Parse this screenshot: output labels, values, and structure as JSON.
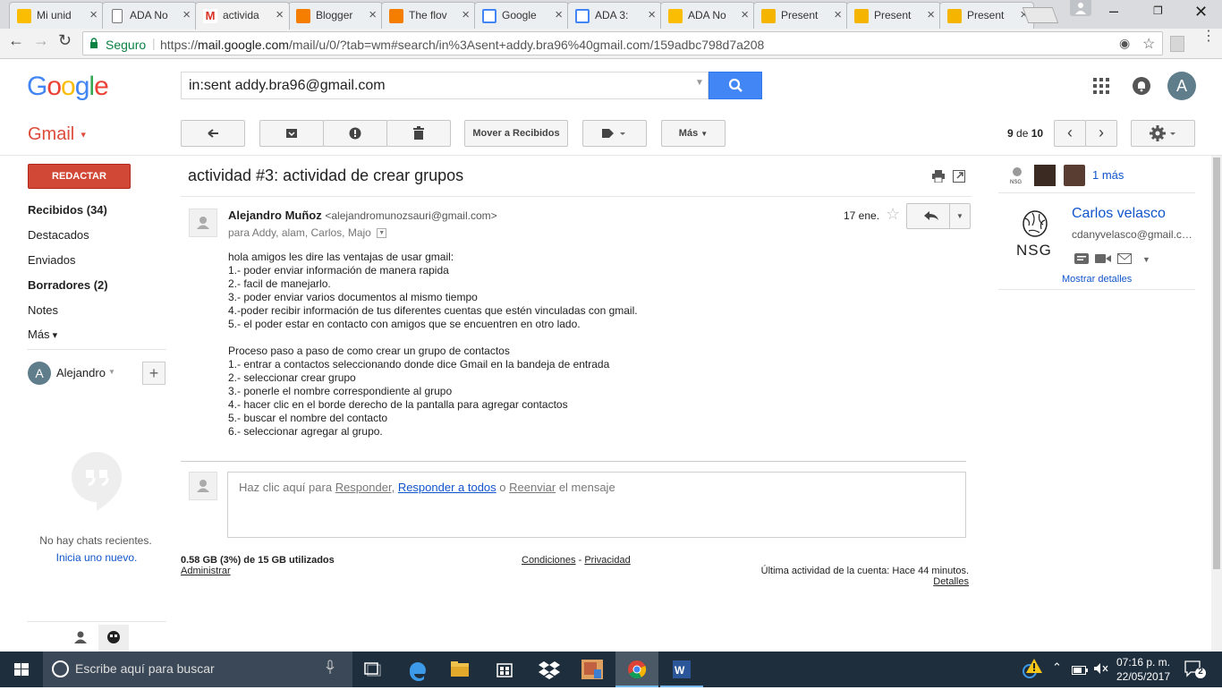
{
  "browser": {
    "tabs": [
      {
        "label": "Mi unid",
        "icon": "google-drive-icon"
      },
      {
        "label": "ADA No",
        "icon": "document-icon"
      },
      {
        "label": "activida",
        "icon": "gmail-icon"
      },
      {
        "label": "Blogger",
        "icon": "blogger-icon"
      },
      {
        "label": "The flov",
        "icon": "blogger-icon"
      },
      {
        "label": "Google",
        "icon": "google-forms-icon"
      },
      {
        "label": "ADA 3:",
        "icon": "google-forms-icon"
      },
      {
        "label": "ADA No",
        "icon": "google-drive-icon"
      },
      {
        "label": "Present",
        "icon": "slides-icon"
      },
      {
        "label": "Present",
        "icon": "slides-icon"
      },
      {
        "label": "Present",
        "icon": "slides-icon"
      }
    ],
    "secure_label": "Seguro",
    "url_scheme": "https://",
    "url_host": "mail.google.com",
    "url_path": "/mail/u/0/?tab=wm#search/in%3Asent+addy.bra96%40gmail.com/159adbc798d7a208",
    "colors": {
      "secure": "#0b8043",
      "tabbar": "#dadbde"
    }
  },
  "header": {
    "logo": "Google",
    "search_value": "in:sent addy.bra96@gmail.com",
    "avatar_letter": "A"
  },
  "toolbar": {
    "app_name": "Gmail",
    "move_to_inbox": "Mover a Recibidos",
    "more": "Más",
    "page_current": "9",
    "page_of": "de",
    "page_total": "10"
  },
  "sidebar": {
    "compose": "REDACTAR",
    "items": [
      {
        "label": "Recibidos (34)",
        "bold": true
      },
      {
        "label": "Destacados",
        "bold": false
      },
      {
        "label": "Enviados",
        "bold": false
      },
      {
        "label": "Borradores (2)",
        "bold": true
      },
      {
        "label": "Notes",
        "bold": false
      },
      {
        "label": "Más",
        "bold": false
      }
    ],
    "hangouts_user": "Alejandro",
    "hangouts_avatar": "A",
    "no_chats": "No hay chats recientes.",
    "start_new": "Inicia uno nuevo."
  },
  "thread": {
    "subject": "actividad #3: actividad de crear grupos",
    "sender_name": "Alejandro Muñoz",
    "sender_email": "<alejandromunozsauri@gmail.com>",
    "recipients": "para Addy, alam, Carlos, Majo",
    "date": "17 ene.",
    "body": [
      "hola amigos les dire las ventajas de usar gmail:",
      "1.- poder enviar información de manera rapida",
      "2.- facil de manejarlo.",
      "3.- poder enviar varios documentos al mismo tiempo",
      "4.-poder recibir información de tus diferentes cuentas que estén vinculadas con gmail.",
      "5.- el poder estar en contacto con amigos que se encuentren en otro lado.",
      "",
      "Proceso paso a paso de como crear un grupo de contactos",
      "1.- entrar a contactos seleccionando donde dice Gmail en la bandeja de entrada",
      "2.- seleccionar crear grupo",
      "3.- ponerle el nombre correspondiente al grupo",
      "4.- hacer clic en el borde derecho de la pantalla para agregar contactos",
      "5.- buscar el nombre del contacto",
      "6.- seleccionar agregar al grupo."
    ],
    "reply_prefix": "Haz clic aquí para",
    "reply_link": "Responder,",
    "reply_all_link": "Responder a todos",
    "reply_or": "o",
    "forward_link": "Reenviar",
    "reply_suffix": "el mensaje"
  },
  "footer": {
    "storage": "0.58 GB (3%) de 15 GB utilizados",
    "manage": "Administrar",
    "terms": "Condiciones",
    "dash": "-",
    "privacy": "Privacidad",
    "last_activity": "Última actividad de la cuenta: Hace 44 minutos.",
    "details": "Detalles"
  },
  "right_panel": {
    "more_people": "1 más",
    "contact_name": "Carlos velasco",
    "contact_email": "cdanyvelasco@gmail.com",
    "contact_logo": "NSG",
    "show_details": "Mostrar detalles"
  },
  "taskbar": {
    "search_placeholder": "Escribe aquí para buscar",
    "time": "07:16 p. m.",
    "date": "22/05/2017",
    "notifications": "2"
  }
}
